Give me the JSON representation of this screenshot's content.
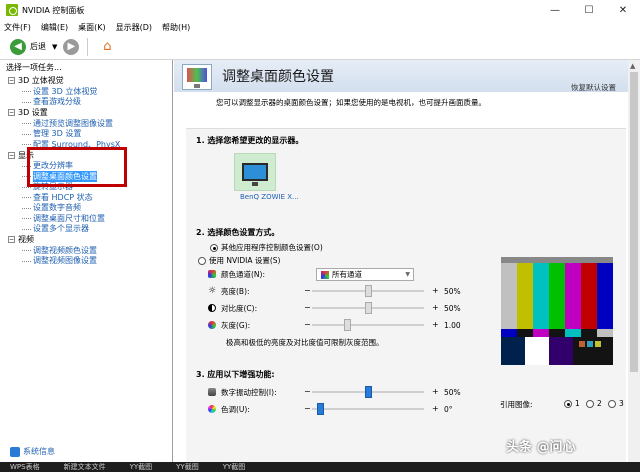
{
  "window": {
    "title": "NVIDIA 控制面板",
    "minimize": "—",
    "maximize": "☐",
    "close": "✕"
  },
  "menu": [
    "文件(F)",
    "编辑(E)",
    "桌面(K)",
    "显示器(D)",
    "帮助(H)"
  ],
  "toolbar": {
    "back_label": "后退"
  },
  "left": {
    "task_header": "选择一项任务...",
    "tree": [
      {
        "label": "3D 立体视觉",
        "items": [
          "设置 3D 立体视觉",
          "查看游戏分级"
        ]
      },
      {
        "label": "3D 设置",
        "items": [
          "通过预览调整图像设置",
          "管理 3D 设置",
          "配置 Surround、PhysX"
        ]
      },
      {
        "label": "显示",
        "items": [
          "更改分辨率",
          "调整桌面颜色设置",
          "旋转显示器",
          "查看 HDCP 状态",
          "设置数字音频",
          "调整桌面尺寸和位置",
          "设置多个显示器"
        ]
      },
      {
        "label": "视频",
        "items": [
          "调整视频颜色设置",
          "调整视频图像设置"
        ]
      }
    ],
    "selected_item": "调整桌面颜色设置",
    "system_info": "系统信息"
  },
  "main": {
    "title": "调整桌面颜色设置",
    "restore_defaults": "恢复默认设置",
    "description": "您可以调整显示器的桌面颜色设置；如果您使用的是电视机，也可提升画面质量。",
    "section1": {
      "title": "1.  选择您希望更改的显示器。",
      "monitor": "BenQ ZOWIE X..."
    },
    "section2": {
      "title": "2.  选择颜色设置方式。",
      "option_other": "其他应用程序控制颜色设置(O)",
      "option_nvidia": "使用 NVIDIA 设置(S)",
      "channel_label": "颜色通道(N):",
      "channel_value": "所有通道",
      "brightness_label": "亮度(B):",
      "brightness_value": "50%",
      "brightness_level": 0.5,
      "contrast_label": "对比度(C):",
      "contrast_value": "50%",
      "contrast_level": 0.5,
      "gamma_label": "灰度(G):",
      "gamma_value": "1.00",
      "gamma_level": 0.3,
      "note": "极高和极低的亮度及对比度值可限制灰度范围。"
    },
    "section3": {
      "title": "3.  应用以下增强功能:",
      "vibrance_label": "数字振动控制(I):",
      "vibrance_value": "50%",
      "vibrance_level": 0.5,
      "hue_label": "色调(U):",
      "hue_value": "0°",
      "hue_level": 0.05
    },
    "reference": {
      "label": "引用图像:",
      "options": [
        "1",
        "2",
        "3"
      ]
    },
    "minus": "−",
    "plus": "+"
  },
  "taskbar": [
    "WPS表格",
    "新建文本文件",
    "YY截图",
    "YY截图",
    "YY截图"
  ],
  "watermark": "头条 @问心"
}
